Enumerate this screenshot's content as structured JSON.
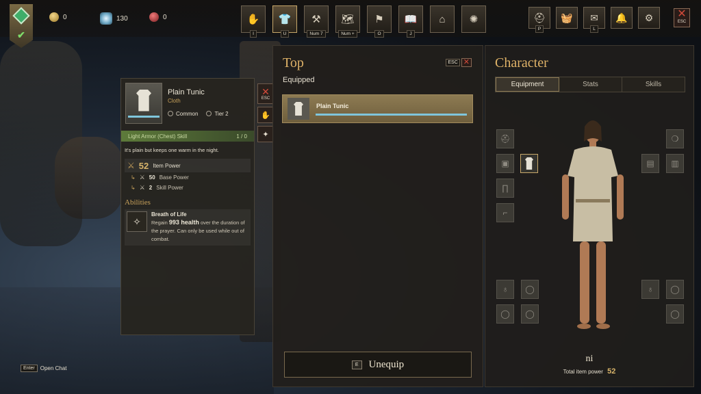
{
  "hud": {
    "currencies": [
      {
        "icon": "coin-icon",
        "value": "0"
      },
      {
        "icon": "azoth-icon",
        "value": "130"
      },
      {
        "icon": "faction-token-icon",
        "value": "0"
      }
    ],
    "menu": [
      {
        "name": "inventory",
        "key": "I",
        "glyph": "✋"
      },
      {
        "name": "equipment",
        "key": "U",
        "glyph": "👕",
        "active": true
      },
      {
        "name": "crafting",
        "key": "Num 7",
        "glyph": "⚒"
      },
      {
        "name": "map",
        "key": "Num +",
        "glyph": "🗺"
      },
      {
        "name": "territory",
        "key": "O",
        "glyph": "⚑"
      },
      {
        "name": "journal",
        "key": "J",
        "glyph": "📖"
      },
      {
        "name": "market",
        "key": "",
        "glyph": "⌂"
      },
      {
        "name": "settings-wheel",
        "key": "",
        "glyph": "✺"
      }
    ],
    "right_menu": [
      {
        "name": "company",
        "key": "P",
        "glyph": "⛑"
      },
      {
        "name": "store",
        "key": "",
        "glyph": "🧺"
      },
      {
        "name": "mail",
        "key": "L",
        "glyph": "✉"
      },
      {
        "name": "notifications",
        "key": "",
        "glyph": "🔔"
      },
      {
        "name": "options",
        "key": "",
        "glyph": "⚙"
      }
    ],
    "esc_label": "ESC"
  },
  "tooltip": {
    "item_name": "Plain Tunic",
    "item_type": "Cloth",
    "rarity": "Common",
    "tier": "Tier 2",
    "skill_label": "Light Armor (Chest) Skill",
    "skill_value": "1 / 0",
    "description": "It's plain but keeps one warm in the night.",
    "item_power_value": "52",
    "item_power_label": "Item Power",
    "base_power_value": "50",
    "base_power_label": "Base Power",
    "skill_power_value": "2",
    "skill_power_label": "Skill Power",
    "abilities_title": "Abilities",
    "ability_name": "Breath of Life",
    "ability_pre": "Regain",
    "ability_highlight": "993 health",
    "ability_post": "over the duration of the prayer. Can only be used while out of combat.",
    "side_esc": "ESC"
  },
  "middle": {
    "title": "Top",
    "esc": "ESC",
    "equipped_label": "Equipped",
    "equipped_item": "Plain Tunic",
    "unequip_key": "E",
    "unequip_label": "Unequip"
  },
  "character": {
    "title": "Character",
    "tabs": [
      "Equipment",
      "Stats",
      "Skills"
    ],
    "active_tab": "Equipment",
    "name": "ni",
    "total_power_label": "Total item power",
    "total_power_value": "52"
  },
  "chat": {
    "key": "Enter",
    "label": "Open Chat"
  },
  "colors": {
    "gold": "#e0b368",
    "durability": "#7fc6dc",
    "skill_green": "#5d7a3a",
    "close_red": "#d24a3a"
  }
}
